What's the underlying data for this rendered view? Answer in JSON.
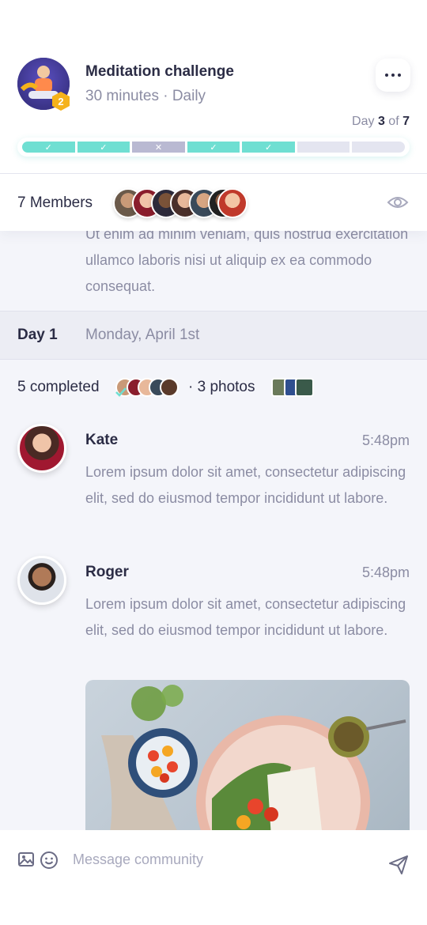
{
  "header": {
    "title": "Meditation challenge",
    "subtitle": "30 minutes · Daily",
    "avatar_badge": "2",
    "day_progress": {
      "prefix": "Day ",
      "current": "3",
      "middle": " of ",
      "total": "7"
    },
    "progress_segments": [
      "done",
      "done",
      "missed",
      "done",
      "done",
      "todo",
      "todo"
    ],
    "members_label": "7 Members"
  },
  "feed": {
    "partial_text": "Ut enim ad minim veniam, quis nostrud exercitation ullamco laboris nisi ut aliquip ex ea commodo consequat.",
    "day": {
      "label": "Day 1",
      "date": "Monday, April 1st"
    },
    "completed_label": "5 completed",
    "photos_label": "· 3 photos",
    "posts": [
      {
        "name": "Kate",
        "time": "5:48pm",
        "text": "Lorem ipsum dolor sit amet, consectetur adipiscing elit, sed do eiusmod tempor incididunt ut labore."
      },
      {
        "name": "Roger",
        "time": "5:48pm",
        "text": "Lorem ipsum dolor sit amet, consectetur adipiscing elit, sed do eiusmod tempor incididunt ut labore."
      }
    ]
  },
  "composer": {
    "placeholder": "Message community"
  },
  "colors": {
    "accent": "#6fdfd2",
    "missed": "#b9b9d2",
    "badge": "#f5b21a",
    "primary_text": "#2b2c45",
    "muted_text": "#8b8ca3"
  }
}
